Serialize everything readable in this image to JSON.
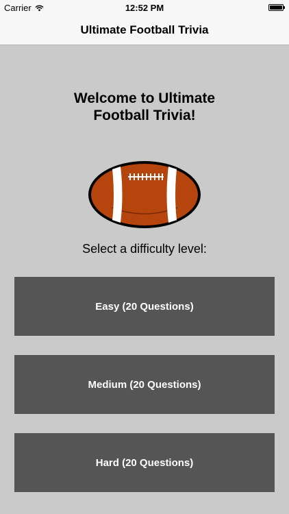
{
  "status_bar": {
    "carrier": "Carrier",
    "time": "12:52 PM"
  },
  "nav": {
    "title": "Ultimate Football Trivia"
  },
  "main": {
    "welcome_line1": "Welcome to Ultimate",
    "welcome_line2": "Football Trivia!",
    "prompt": "Select a difficulty level:",
    "buttons": [
      {
        "label": "Easy (20 Questions)"
      },
      {
        "label": "Medium (20 Questions)"
      },
      {
        "label": "Hard (20 Questions)"
      }
    ]
  },
  "colors": {
    "background": "#cacaca",
    "button": "#555555",
    "button_text": "#ffffff",
    "football": "#b5440d"
  },
  "icons": [
    "wifi-icon",
    "battery-icon",
    "football-icon"
  ]
}
